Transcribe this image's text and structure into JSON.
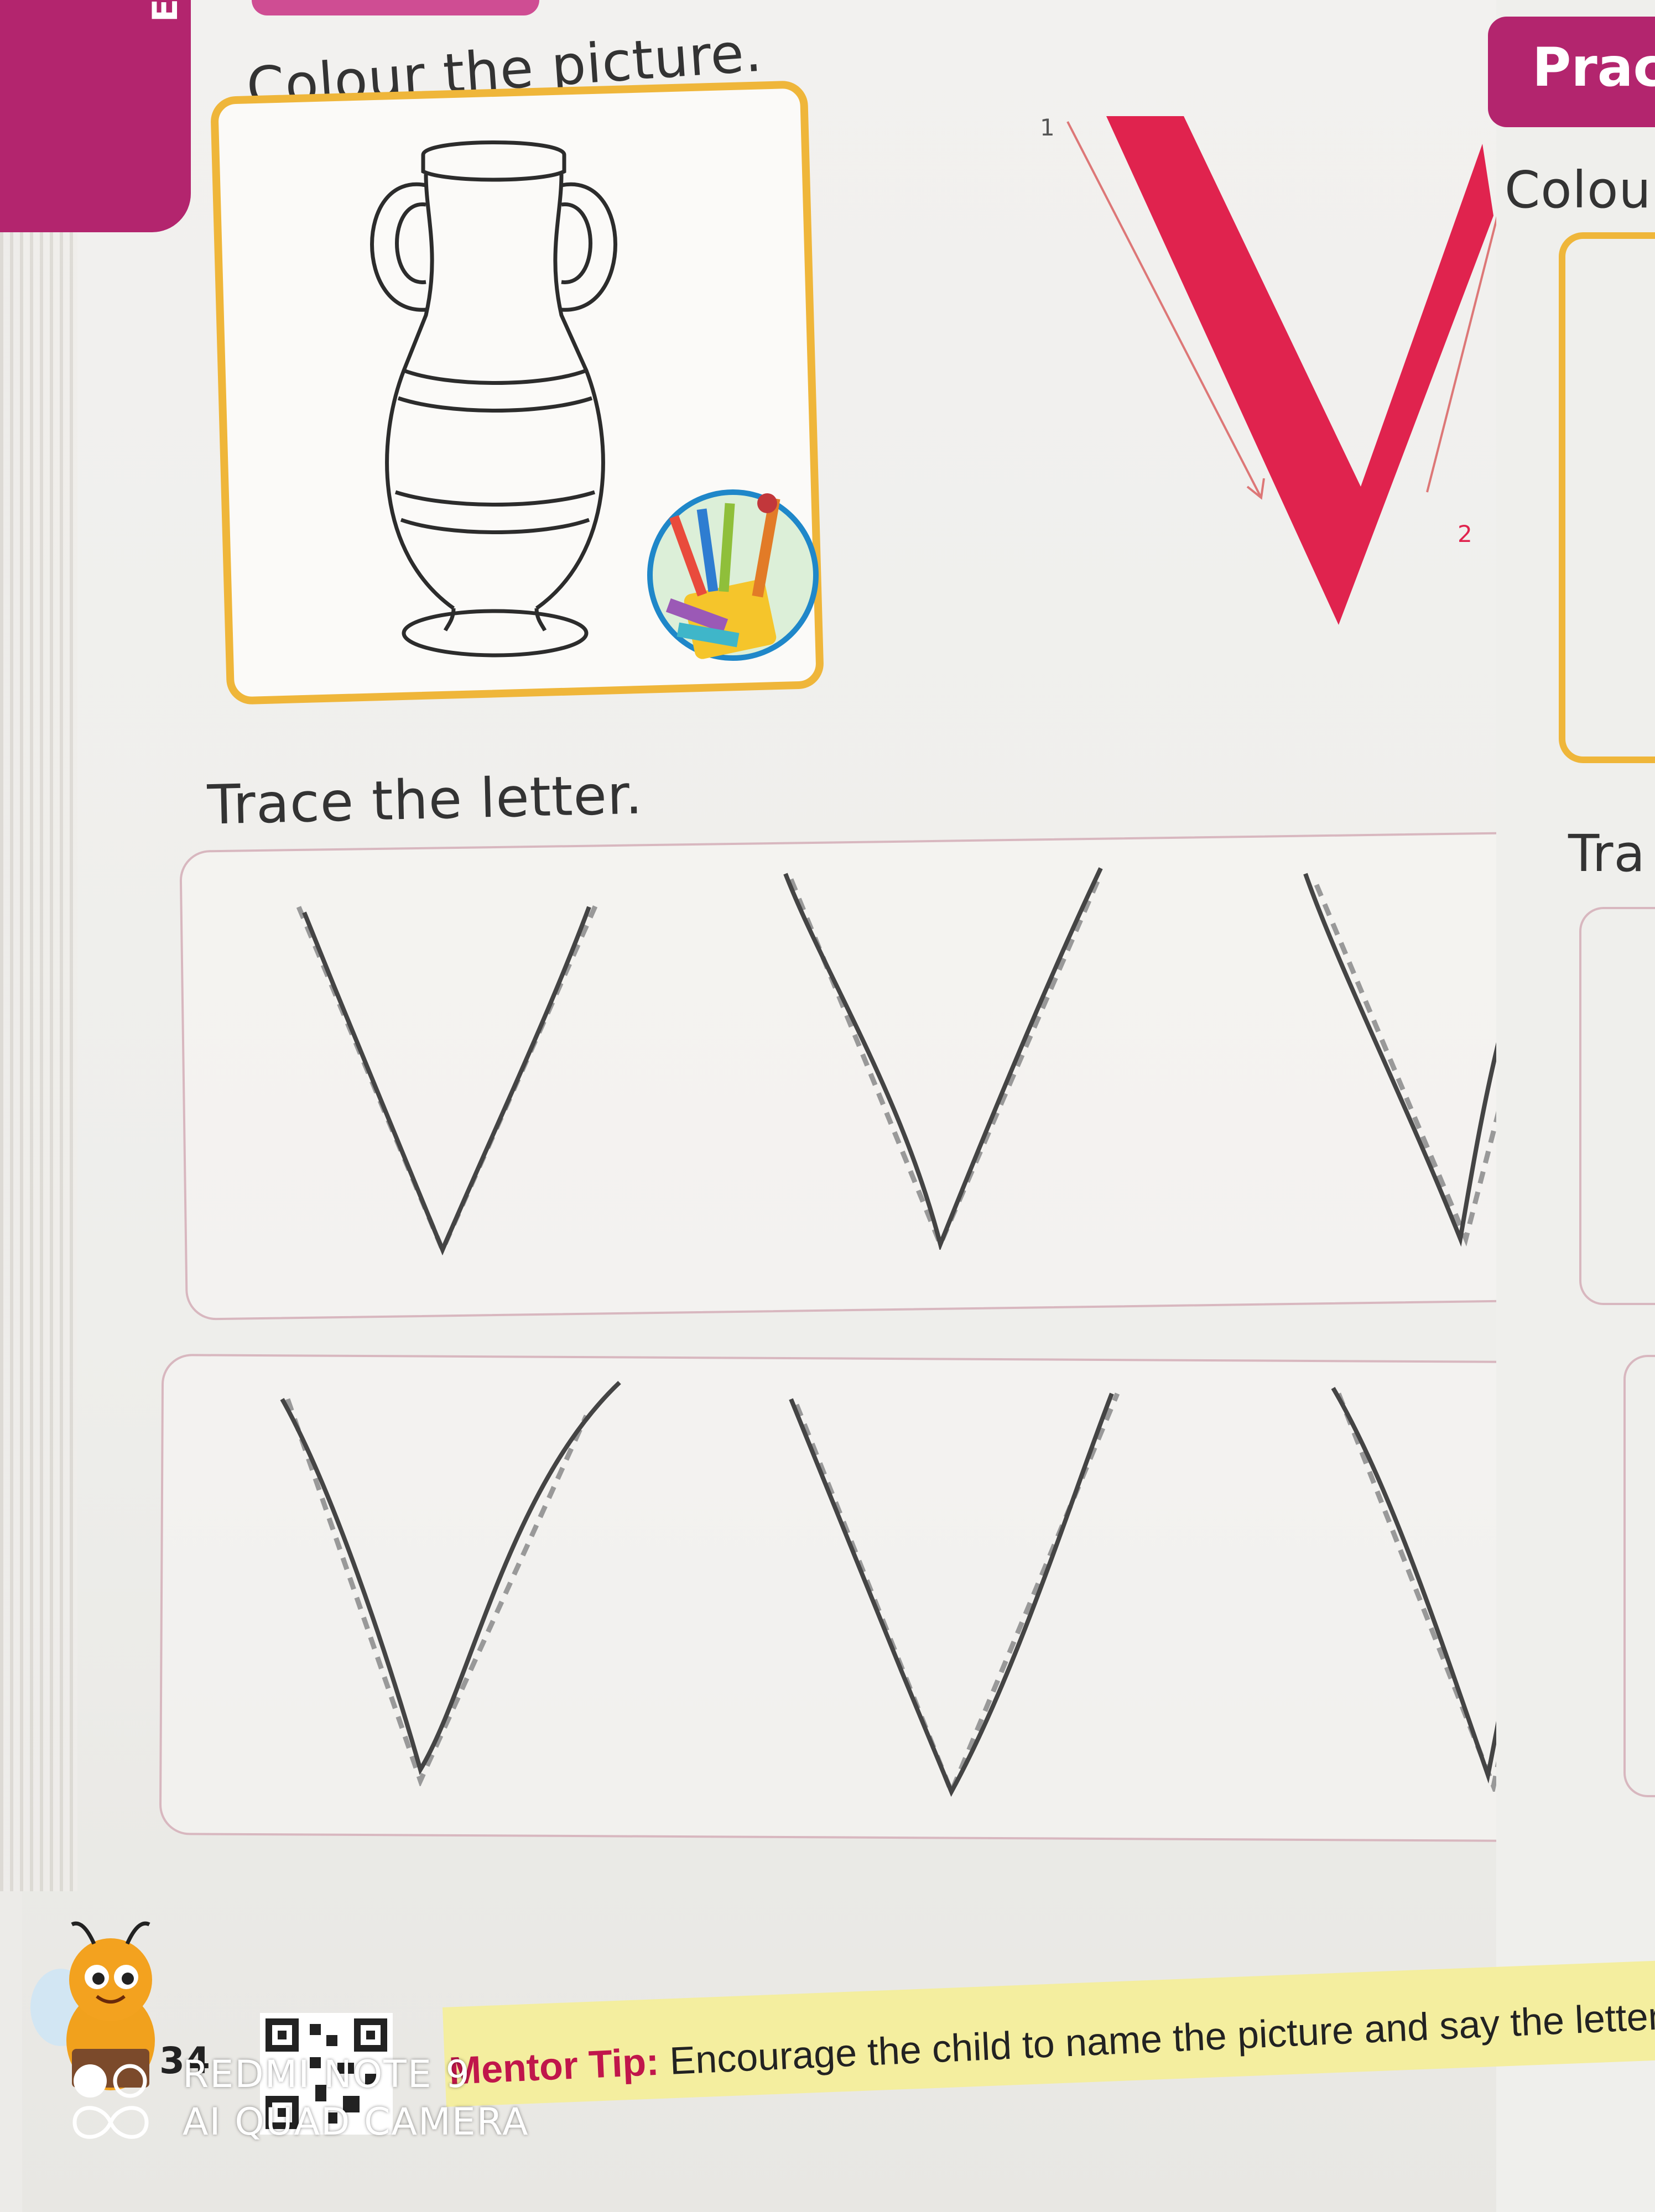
{
  "book": {
    "side_tab_label": "Englis",
    "colour_instruction": "Colour the picture.",
    "trace_instruction": "Trace the letter.",
    "page_number": "34",
    "mentor_tip_label": "Mentor Tip:",
    "mentor_tip_text": " Encourage the child to name the picture and say the letter while tracing"
  },
  "letter_guide": {
    "letter": "V",
    "stroke_1_number": "1",
    "stroke_2_number": "2",
    "color": "#e0234e"
  },
  "right_page": {
    "tab_label": "Prac",
    "colour_instruction_partial": "Colou",
    "trace_instruction_partial": "Tra"
  },
  "camera_watermark": {
    "line_1": "REDMI NOTE 9",
    "line_2": "AI QUAD CAMERA"
  },
  "icons": [
    "vase-illustration",
    "crayon-cup-icon",
    "bee-mascot-icon",
    "qr-code-icon",
    "camera-lens-logo-icon"
  ],
  "colors": {
    "magenta_tab": "#b3256e",
    "frame_yellow": "#efb63a",
    "letter_red": "#e0234e",
    "tip_strip": "#f4ee9f"
  }
}
